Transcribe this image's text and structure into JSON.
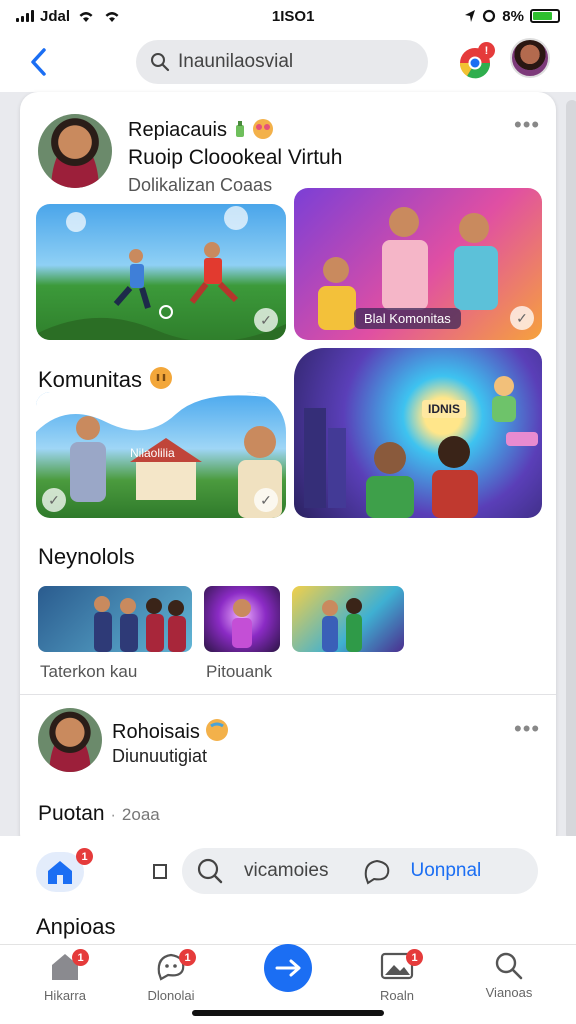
{
  "status": {
    "time": "1ISO1",
    "carrier": "Jdal",
    "battery": "8%"
  },
  "search": {
    "text": "Inaunilaosvial"
  },
  "post1": {
    "name": "Repiacauis",
    "title": "Ruoip Cloookeal Virtuh",
    "meta": "Dolikalizan Coaas",
    "image2_label": "Blal Komonitas"
  },
  "section1": {
    "heading": "Komunitas",
    "image3_label": "Nilaolilia",
    "image4_sign": "IDNIS"
  },
  "section2": {
    "heading": "Neynolols",
    "thumbs": [
      {
        "caption": "Taterkon kau"
      },
      {
        "caption": "Pitouank"
      },
      {
        "caption": ""
      }
    ]
  },
  "post2": {
    "name": "Rohoisais",
    "sub": "Diunuutigiat"
  },
  "post3": {
    "heading": "Puotan",
    "year": "2oaa"
  },
  "bottom_bar": {
    "search_text": "vicamoies",
    "action": "Uonpnal",
    "home_badge": "1"
  },
  "section3": {
    "heading": "Anpioas"
  },
  "tabs": [
    {
      "label": "Hikarra",
      "badge": "1"
    },
    {
      "label": "Dlonolai",
      "badge": "1"
    },
    {
      "label": "Roaln",
      "badge": "1"
    },
    {
      "label": "Vianoas",
      "badge": ""
    }
  ],
  "colors": {
    "accent": "#1b6ef3",
    "badge": "#e53b3b"
  }
}
